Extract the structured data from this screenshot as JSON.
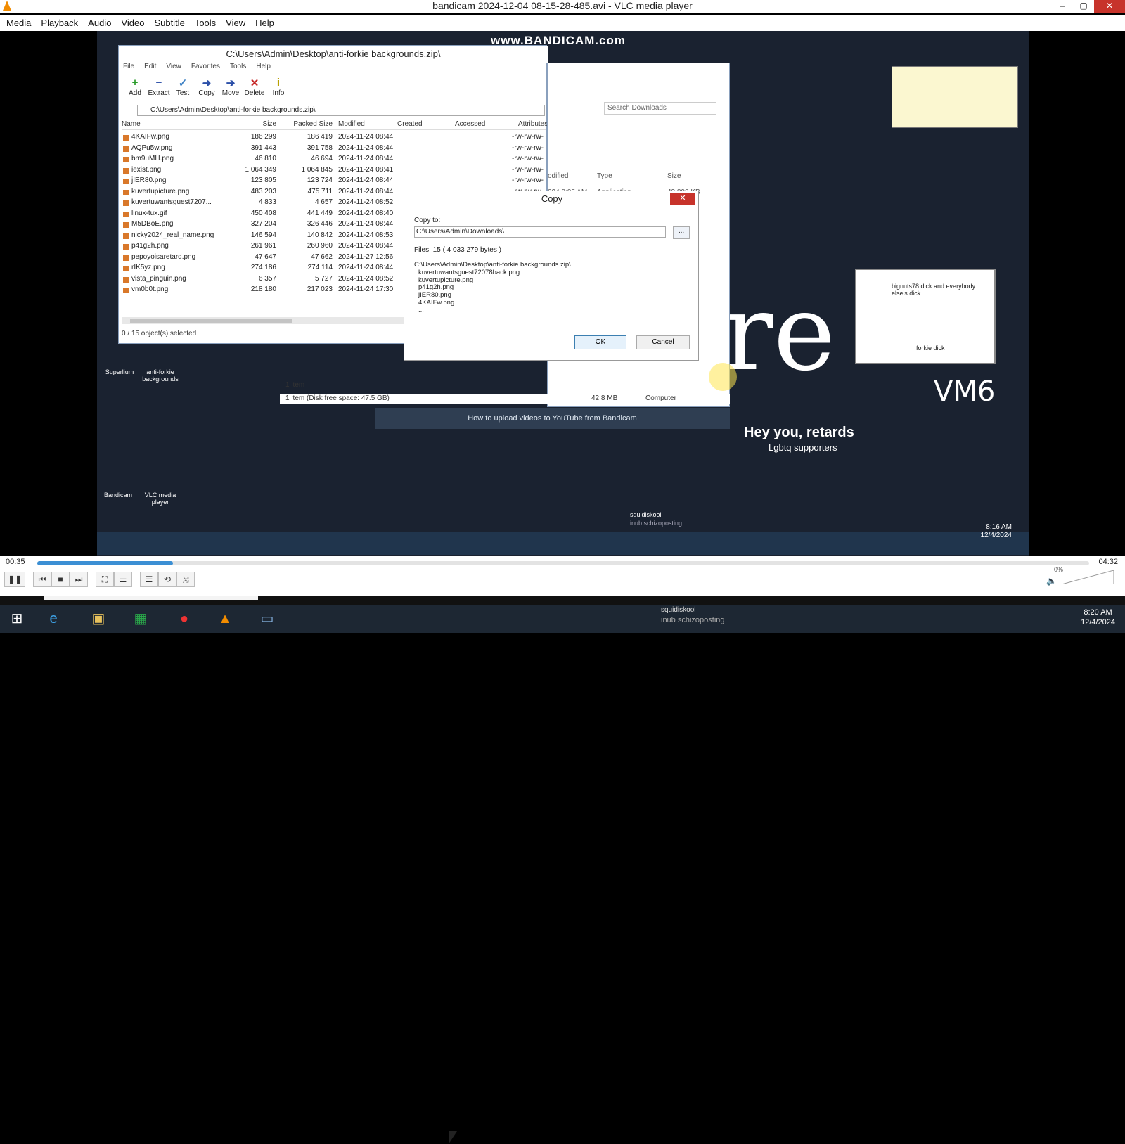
{
  "vlc": {
    "title": "bandicam 2024-12-04 08-15-28-485.avi - VLC media player",
    "window_controls": [
      "–",
      "▢",
      "✕"
    ],
    "menu": [
      "Media",
      "Playback",
      "Audio",
      "Video",
      "Subtitle",
      "Tools",
      "View",
      "Help"
    ],
    "time_current": "00:35",
    "time_total": "04:32",
    "seek_percent": 12.9,
    "volume": "0%",
    "controls": [
      "❚❚",
      "⏮",
      "■",
      "⏭",
      "⛶",
      "⚌",
      "☰",
      "⟲",
      "⤨"
    ]
  },
  "video": {
    "watermark": "www.BANDICAM.com",
    "zip_window": {
      "title": "C:\\Users\\Admin\\Desktop\\anti-forkie backgrounds.zip\\",
      "menu": [
        "File",
        "Edit",
        "View",
        "Favorites",
        "Tools",
        "Help"
      ],
      "toolbar": [
        {
          "label": "Add",
          "icon": "+"
        },
        {
          "label": "Extract",
          "icon": "−"
        },
        {
          "label": "Test",
          "icon": "✓"
        },
        {
          "label": "Copy",
          "icon": "➜"
        },
        {
          "label": "Move",
          "icon": "➔"
        },
        {
          "label": "Delete",
          "icon": "✕"
        },
        {
          "label": "Info",
          "icon": "i"
        }
      ],
      "path": "C:\\Users\\Admin\\Desktop\\anti-forkie backgrounds.zip\\",
      "headers": [
        "Name",
        "Size",
        "Packed Size",
        "Modified",
        "Created",
        "Accessed",
        "Attributes"
      ],
      "rows": [
        [
          "4KAIFw.png",
          "186 299",
          "186 419",
          "2024-11-24 08:44",
          "-rw-rw-rw-"
        ],
        [
          "AQPu5w.png",
          "391 443",
          "391 758",
          "2024-11-24 08:44",
          "-rw-rw-rw-"
        ],
        [
          "bm9uMH.png",
          "46 810",
          "46 694",
          "2024-11-24 08:44",
          "-rw-rw-rw-"
        ],
        [
          "iexist.png",
          "1 064 349",
          "1 064 845",
          "2024-11-24 08:41",
          "-rw-rw-rw-"
        ],
        [
          "jIER80.png",
          "123 805",
          "123 724",
          "2024-11-24 08:44",
          "-rw-rw-rw-"
        ],
        [
          "kuvertupicture.png",
          "483 203",
          "475 711",
          "2024-11-24 08:44",
          "-rw-rw-rw-"
        ],
        [
          "kuvertuwantsguest7207...",
          "4 833",
          "4 657",
          "2024-11-24 08:52",
          "-rw-rw-rw-"
        ],
        [
          "linux-tux.gif",
          "450 408",
          "441 449",
          "2024-11-24 08:40",
          "-rw-rw-rw-"
        ],
        [
          "M5DBoE.png",
          "327 204",
          "326 446",
          "2024-11-24 08:44",
          "-rw-rw-rw-"
        ],
        [
          "nicky2024_real_name.png",
          "146 594",
          "140 842",
          "2024-11-24 08:53",
          "-rw-rw-rw-"
        ],
        [
          "p41g2h.png",
          "261 961",
          "260 960",
          "2024-11-24 08:44",
          "-rw-rw-rw-"
        ],
        [
          "pepoyoisaretard.png",
          "47 647",
          "47 662",
          "2024-11-27 12:56",
          "-rw-rw-rw-"
        ],
        [
          "rIK5yz.png",
          "274 186",
          "274 114",
          "2024-11-24 08:44",
          "-rw-rw-rw-"
        ],
        [
          "vista_pinguin.png",
          "6 357",
          "5 727",
          "2024-11-24 08:52",
          "-rw-rw-rw-"
        ],
        [
          "vm0b0t.png",
          "218 180",
          "217 023",
          "2024-11-24 17:30",
          "-rw-rw-rw-"
        ]
      ],
      "status": "0 / 15 object(s) selected"
    },
    "explorer": {
      "search_placeholder": "Search Downloads",
      "cols": [
        "odified",
        "Type",
        "Size"
      ],
      "row": [
        "024 8:05 AM",
        "Application",
        "43,890 KB"
      ],
      "status_items": "1 item",
      "status_disk": "1 item (Disk free space: 47.5 GB)",
      "status_size": "42.8 MB",
      "status_computer": "Computer"
    },
    "copy_dialog": {
      "title": "Copy",
      "copy_to_label": "Copy to:",
      "copy_to_value": "C:\\Users\\Admin\\Downloads\\",
      "browse_label": "...",
      "files_summary": "Files: 15    ( 4 033 279 bytes )",
      "list_header": "C:\\Users\\Admin\\Desktop\\anti-forkie backgrounds.zip\\",
      "list": [
        "kuvertuwantsguest72078back.png",
        "kuvertupicture.png",
        "p41g2h.png",
        "jIER80.png",
        "4KAIFw.png",
        "..."
      ],
      "ok_label": "OK",
      "cancel_label": "Cancel",
      "close_label": "✕"
    },
    "youtube_notice": "How to upload videos to YouTube from Bandicam",
    "hey_you": "Hey you, retards",
    "lgbtq_line": "Lgbtq supporters",
    "vm6": "VM6",
    "re_text": "re",
    "bignuts_note": "bignuts78 dick and everybody else's dick",
    "forkie_note": "forkie dick",
    "desktop_labels": [
      "Superlium",
      "anti-forkie backgrounds",
      "Bandicam",
      "VLC media player"
    ],
    "squid_name": "squidiskool",
    "squid_status": "inub schizoposting",
    "recorded_time": "8:16 AM",
    "recorded_date": "12/4/2024"
  },
  "taskbar": {
    "icons": [
      "start-icon",
      "ie-icon",
      "explorer-icon",
      "store-icon",
      "bandicam-icon",
      "vlc-icon",
      "remote-icon"
    ],
    "squid_name": "squidiskool",
    "squid_status": "inub schizoposting",
    "time": "8:20 AM",
    "date": "12/4/2024"
  },
  "colors": {
    "accent": "#3b8fd4",
    "close_red": "#c7332b",
    "vlc_orange": "#f28c00"
  }
}
